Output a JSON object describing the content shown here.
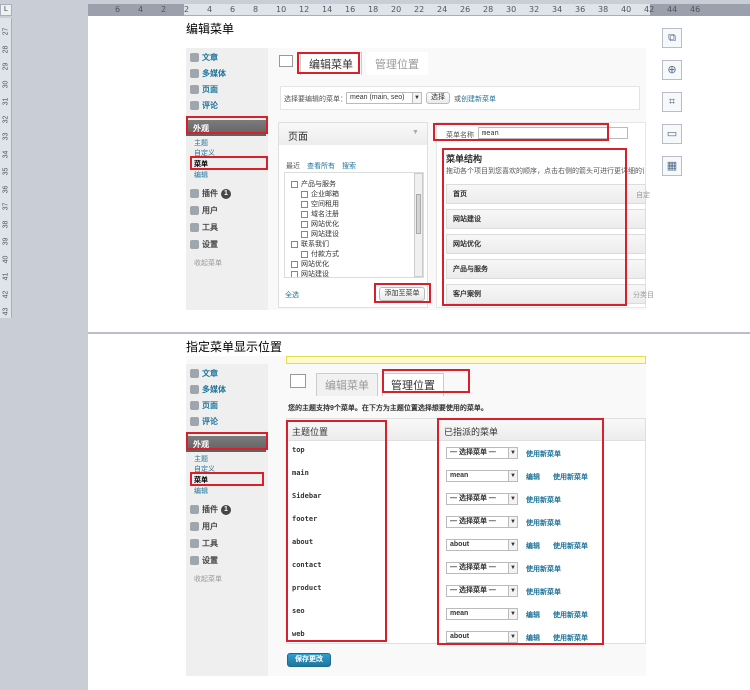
{
  "ruler": {
    "corner": "L",
    "top_ticks": [
      "6",
      "4",
      "2",
      "2",
      "4",
      "6",
      "8",
      "10",
      "12",
      "14",
      "16",
      "18",
      "20",
      "22",
      "24",
      "26",
      "28",
      "30",
      "32",
      "34",
      "36",
      "38",
      "40",
      "42",
      "44",
      "46"
    ],
    "left_ticks": [
      "27",
      "28",
      "29",
      "30",
      "31",
      "32",
      "33",
      "34",
      "35",
      "36",
      "37",
      "38",
      "39",
      "40",
      "41",
      "42",
      "43"
    ]
  },
  "captions": {
    "edit_menu": "编辑菜单",
    "set_location": "指定菜单显示位置"
  },
  "sidebar": {
    "items": [
      {
        "label": "文章",
        "icon": "pin-icon"
      },
      {
        "label": "多媒体",
        "icon": "media-icon"
      },
      {
        "label": "页面",
        "icon": "page-icon"
      },
      {
        "label": "评论",
        "icon": "comment-icon"
      },
      {
        "label": "外观",
        "icon": "appearance-icon"
      },
      {
        "label": "插件",
        "icon": "plugin-icon",
        "badge": "1"
      },
      {
        "label": "用户",
        "icon": "users-icon"
      },
      {
        "label": "工具",
        "icon": "tools-icon"
      },
      {
        "label": "设置",
        "icon": "settings-icon"
      }
    ],
    "sub": [
      "主题",
      "自定义",
      "菜单",
      "编辑"
    ],
    "collapse": "收起菜单"
  },
  "tabs": {
    "edit": "编辑菜单",
    "manage": "管理位置"
  },
  "editor": {
    "choose_label": "选择要编辑的菜单：",
    "choose_value": "mean (main, seo)",
    "choose_button": "选择",
    "or": "或",
    "create_link": "创建新菜单",
    "pages_title": "页面",
    "filter_tabs": [
      "最近",
      "查看所有",
      "搜索"
    ],
    "page_items": [
      "产品与服务",
      "企业邮箱",
      "空间租用",
      "域名注册",
      "网站优化",
      "网站建设",
      "联系我们",
      "付款方式",
      "网站优化",
      "网站建设"
    ],
    "select_all": "全选",
    "add_button": "添加至菜单",
    "menu_name_label": "菜单名称",
    "menu_name_value": "mean",
    "structure_title": "菜单结构",
    "structure_desc": "拖动各个项目到您喜欢的顺序，点击右侧的箭头可进行更详细的设置",
    "menu_items": [
      "首页",
      "网站建设",
      "网站优化",
      "产品与服务",
      "客户案例"
    ],
    "item_type_custom": "自定",
    "item_type_category": "分类目"
  },
  "locations": {
    "intro": "您的主题支持9个菜单。在下方为主题位置选择想要使用的菜单。",
    "col_location": "主题位置",
    "col_assigned": "已指派的菜单",
    "rows": [
      {
        "loc": "top",
        "menu": "— 选择菜单 —",
        "edit": false
      },
      {
        "loc": "main",
        "menu": "mean",
        "edit": true
      },
      {
        "loc": "Sidebar",
        "menu": "— 选择菜单 —",
        "edit": false
      },
      {
        "loc": "footer",
        "menu": "— 选择菜单 —",
        "edit": false
      },
      {
        "loc": "about",
        "menu": "about",
        "edit": true
      },
      {
        "loc": "contact",
        "menu": "— 选择菜单 —",
        "edit": false
      },
      {
        "loc": "product",
        "menu": "— 选择菜单 —",
        "edit": false
      },
      {
        "loc": "seo",
        "menu": "mean",
        "edit": true
      },
      {
        "loc": "web",
        "menu": "about",
        "edit": true
      }
    ],
    "edit_link": "编辑",
    "use_new": "使用新菜单",
    "save": "保存更改"
  },
  "right_tools": [
    "chart-icon",
    "zoom-icon",
    "crop-icon",
    "frame-icon",
    "layout-icon"
  ]
}
